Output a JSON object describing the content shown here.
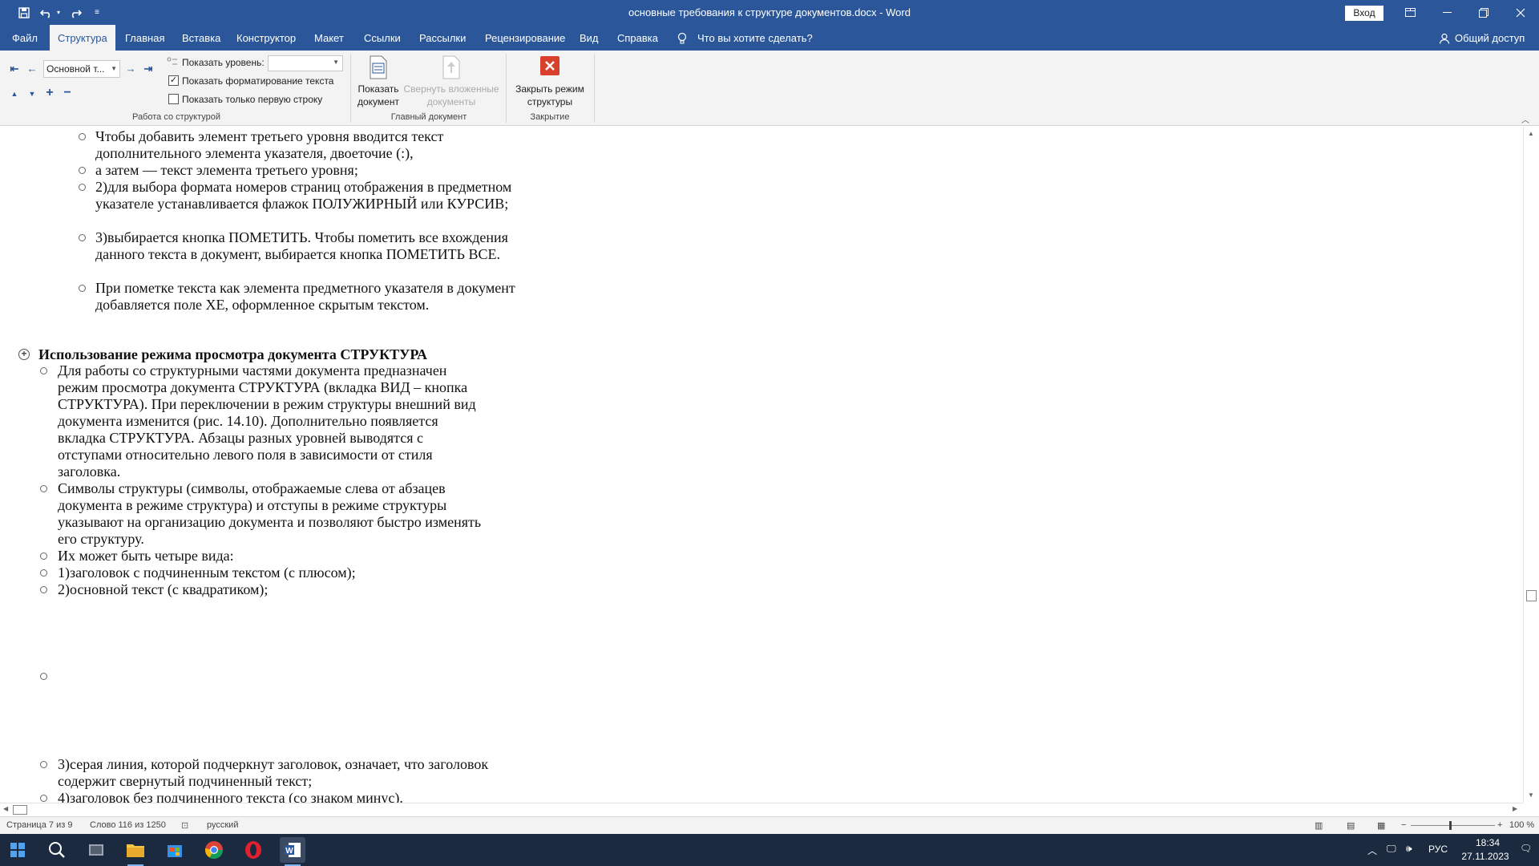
{
  "window": {
    "title": "основные требования к структуре документов.docx  -  Word",
    "signin_label": "Вход",
    "share_label": "Общий доступ"
  },
  "quick_access": {
    "icons": [
      "save-icon",
      "undo-icon",
      "redo-icon",
      "customize-icon"
    ]
  },
  "tabs": [
    {
      "label": "Файл"
    },
    {
      "label": "Структура",
      "active": true
    },
    {
      "label": "Главная"
    },
    {
      "label": "Вставка"
    },
    {
      "label": "Конструктор"
    },
    {
      "label": "Макет"
    },
    {
      "label": "Ссылки"
    },
    {
      "label": "Рассылки"
    },
    {
      "label": "Рецензирование"
    },
    {
      "label": "Вид"
    },
    {
      "label": "Справка"
    }
  ],
  "tell_me": "Что вы хотите сделать?",
  "ribbon": {
    "level_value": "Основной т...",
    "show_level_label": "Показать уровень:",
    "show_formatting_label": "Показать форматирование текста",
    "show_formatting_checked": true,
    "first_line_label": "Показать только первую строку",
    "first_line_checked": false,
    "group_outline": "Работа со структурой",
    "show_document": "Показать документ",
    "collapse_subdocs": "Свернуть вложенные документы",
    "group_master": "Главный документ",
    "close_outline": "Закрыть режим структуры",
    "group_close": "Закрытие"
  },
  "document": {
    "items": [
      {
        "level": 3,
        "text": "Чтобы добавить элемент третьего уровня вводится текст дополнительного элемента указателя, двоеточие (:),"
      },
      {
        "level": 3,
        "text": "а затем — текст элемента третьего уровня;"
      },
      {
        "level": 3,
        "text": "2)для выбора формата номеров страниц отображения в предметном указателе устанавливается флажок ПОЛУЖИРНЫЙ или КУРСИВ;"
      },
      {
        "level": 3,
        "text": "3)выбирается кнопка ПОМЕТИТЬ. Чтобы пометить все вхождения данного текста в документ, выбирается кнопка ПОМЕТИТЬ ВСЕ."
      },
      {
        "level": 3,
        "text": "При пометке текста как элемента предметного указателя в документ добавляется поле XE, оформленное скрытым текстом."
      }
    ],
    "heading": "Использование режима просмотра документа СТРУКТУРА",
    "body": [
      "Для работы со структурными частями документа предназначен режим просмотра документа СТРУКТУРА (вкладка ВИД – кнопка СТРУКТУРА). При переключении в режим структуры внешний вид документа изменится (рис. 14.10). Дополнительно появляется вкладка СТРУКТУРА. Абзацы разных уровней выводятся с отступами относительно левого поля в зависимости от стиля заголовка.",
      "Символы структуры (символы, отображаемые слева от абзацев документа в режиме структура) и отступы в режиме структуры указывают на организацию документа и позволяют быстро изменять его структуру.",
      "Их может быть четыре вида:",
      "1)заголовок с подчиненным текстом (с плюсом);",
      "2)основной текст (с квадратиком);",
      "",
      "3)серая линия, которой подчеркнут заголовок, означает, что заголовок содержит свернутый подчиненный текст;",
      "4)заголовок без подчиненного текста (со знаком минус)."
    ]
  },
  "status": {
    "page": "Страница 7 из 9",
    "words": "Слово 116 из 1250",
    "language": "русский",
    "zoom": "100 %"
  },
  "taskbar": {
    "lang": "РУС",
    "time": "18:34",
    "date": "27.11.2023"
  },
  "colors": {
    "accent": "#2b579a",
    "close_red": "#d9402c"
  }
}
